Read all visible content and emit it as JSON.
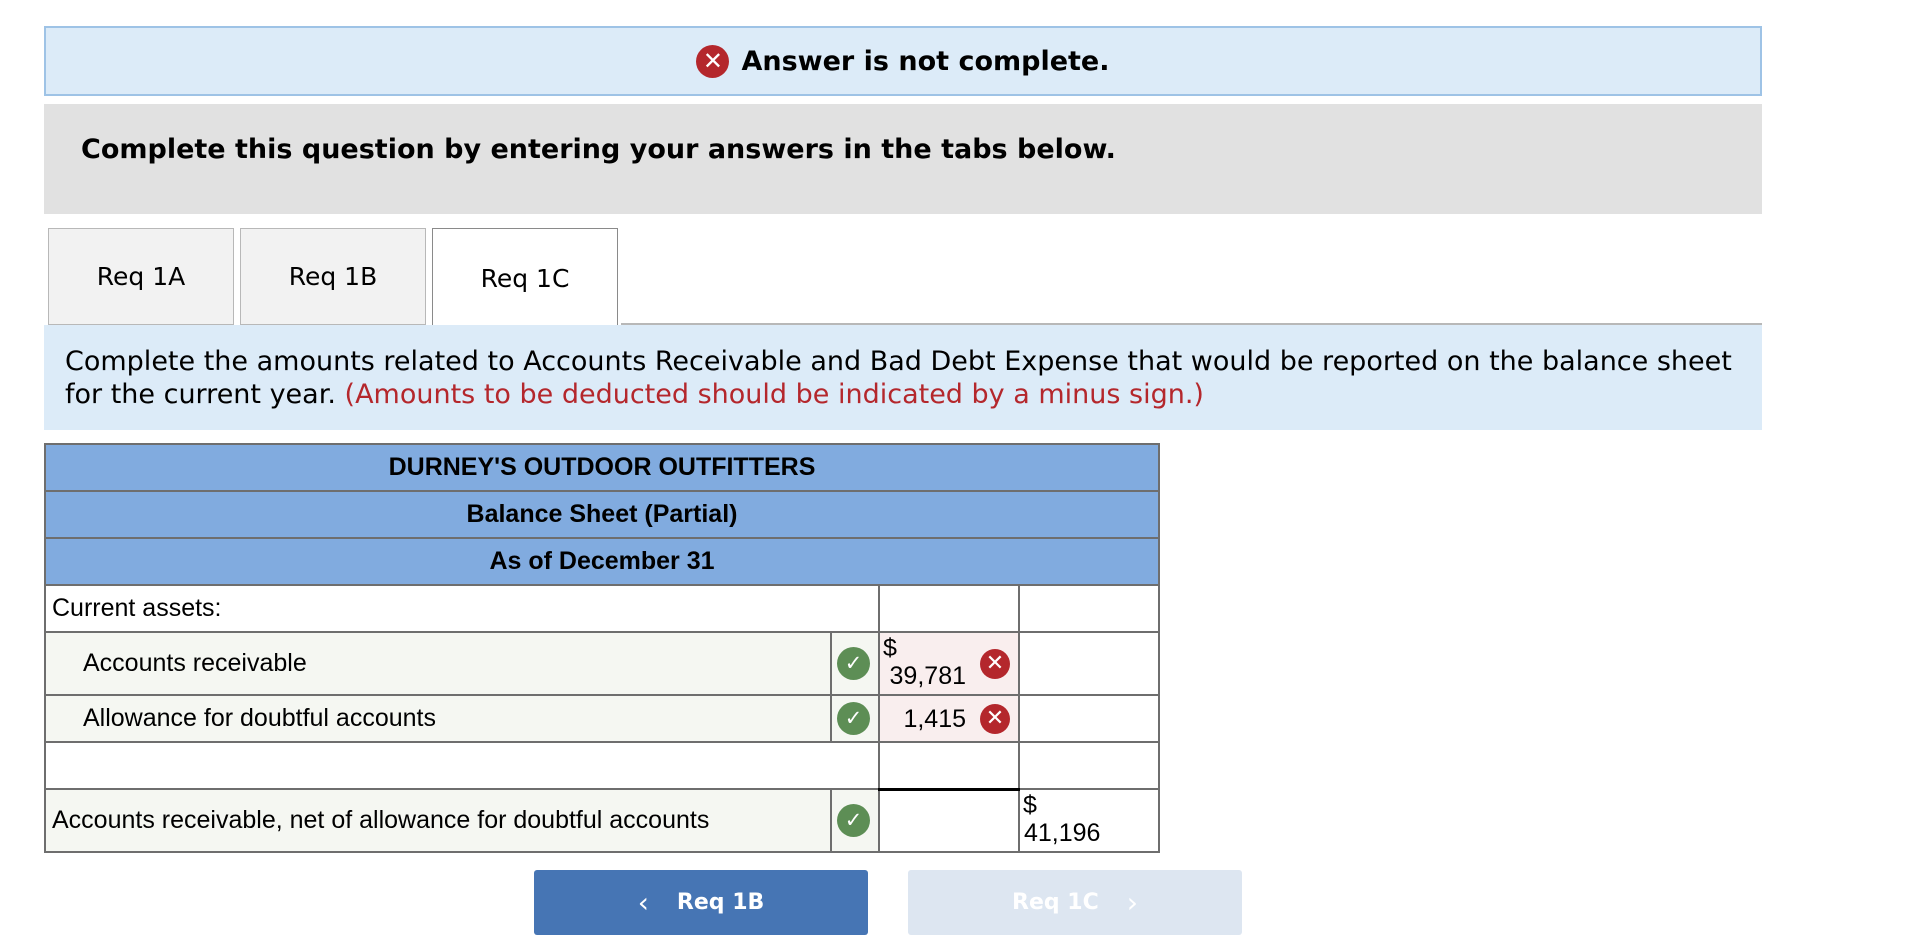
{
  "banner": {
    "status_text": "Answer is not complete.",
    "status_icon": "x-circle-icon"
  },
  "instruction": {
    "text": "Complete this question by entering your answers in the tabs below."
  },
  "tabs": [
    {
      "label": "Req 1A"
    },
    {
      "label": "Req 1B"
    },
    {
      "label": "Req 1C",
      "active": true
    }
  ],
  "question": {
    "text": "Complete the amounts related to Accounts Receivable and Bad Debt Expense that would be reported on the balance sheet for the current year.",
    "note": "(Amounts to be deducted should be indicated by a minus sign.)"
  },
  "balance_sheet": {
    "company": "DURNEY'S OUTDOOR OUTFITTERS",
    "statement": "Balance Sheet (Partial)",
    "date": "As of December 31",
    "section_label": "Current assets:",
    "rows": [
      {
        "label": "Accounts receivable",
        "currency": "$",
        "amount": "39,781",
        "label_status": "correct",
        "amount_status": "incorrect"
      },
      {
        "label": "Allowance for doubtful accounts",
        "currency": "",
        "amount": "1,415",
        "label_status": "correct",
        "amount_status": "incorrect"
      },
      {
        "label": "",
        "amount": ""
      }
    ],
    "total_row": {
      "label": "Accounts receivable, net of allowance for doubtful accounts",
      "currency": "$",
      "amount": "41,196",
      "label_status": "correct"
    }
  },
  "navigation": {
    "prev_label": "Req 1B",
    "next_label": "Req 1C"
  },
  "colors": {
    "header_blue": "#81abdf",
    "error_red": "#b4272c",
    "check_green": "#5d8e55",
    "nav_blue": "#4675b4"
  }
}
